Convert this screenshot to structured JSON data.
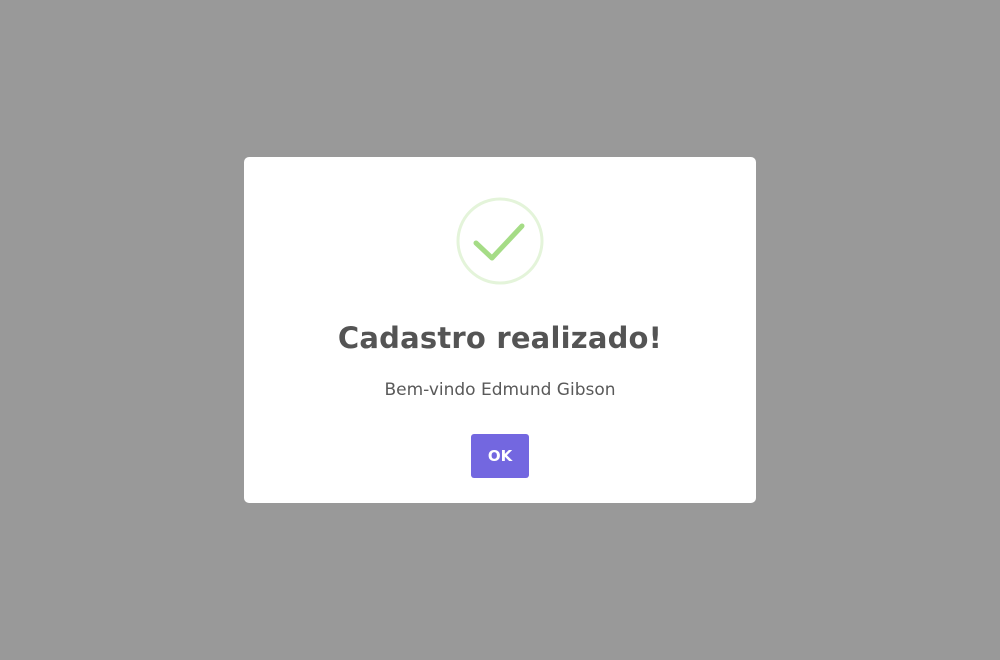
{
  "dialog": {
    "title": "Cadastro realizado!",
    "message": "Bem-vindo Edmund Gibson",
    "confirm_label": "OK",
    "icon": "success-check-icon"
  },
  "colors": {
    "overlay": "#999999",
    "dialog_background": "#ffffff",
    "success_ring": "#e4f4da",
    "success_check": "#a5dc86",
    "title_text": "#545454",
    "message_text": "#595959",
    "button": "#7367e0",
    "button_text": "#ffffff"
  }
}
